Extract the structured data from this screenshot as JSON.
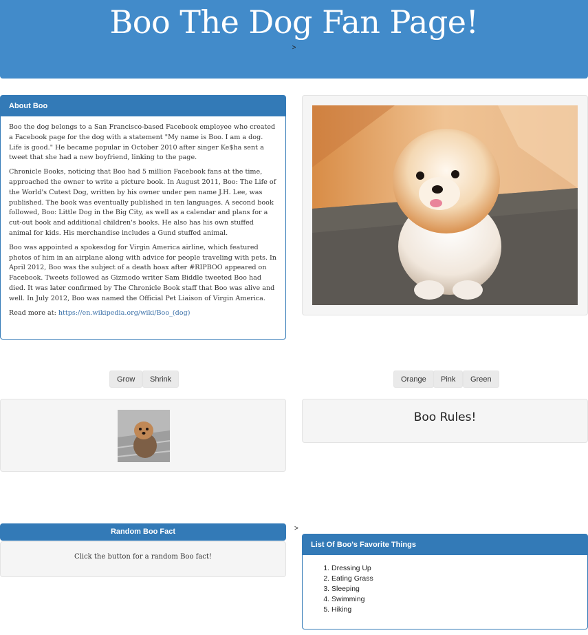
{
  "header": {
    "title": "Boo The Dog Fan Page!",
    "subtitle": ">"
  },
  "about": {
    "heading": "About Boo",
    "paragraphs": [
      "Boo the dog belongs to a San Francisco-based Facebook employee who created a Facebook page for the dog with a statement \"My name is Boo. I am a dog. Life is good.\" He became popular in October 2010 after singer Ke$ha sent a tweet that she had a new boyfriend, linking to the page.",
      "Chronicle Books, noticing that Boo had 5 million Facebook fans at the time, approached the owner to write a picture book. In August 2011, Boo: The Life of the World's Cutest Dog, written by his owner under pen name J.H. Lee, was published. The book was eventually published in ten languages. A second book followed, Boo: Little Dog in the Big City, as well as a calendar and plans for a cut-out book and additional children's books. He also has his own stuffed animal for kids. His merchandise includes a Gund stuffed animal.",
      "Boo was appointed a spokesdog for Virgin America airline, which featured photos of him in an airplane along with advice for people traveling with pets. In April 2012, Boo was the subject of a death hoax after #RIPBOO appeared on Facebook. Tweets followed as Gizmodo writer Sam Biddle tweeted Boo had died. It was later confirmed by The Chronicle Book staff that Boo was alive and well. In July 2012, Boo was named the Official Pet Liaison of Virgin America."
    ],
    "read_more_label": "Read more at: ",
    "read_more_link": "https://en.wikipedia.org/wiki/Boo_(dog)"
  },
  "size_controls": {
    "grow_label": "Grow",
    "shrink_label": "Shrink"
  },
  "color_controls": {
    "orange_label": "Orange",
    "pink_label": "Pink",
    "green_label": "Green"
  },
  "boo_rules": {
    "text": "Boo Rules!"
  },
  "fact": {
    "heading": "Random Boo Fact",
    "text": "Click the button for a random Boo fact!",
    "marker": ">"
  },
  "favorites": {
    "heading": "List Of Boo's Favorite Things",
    "items": [
      "Dressing Up",
      "Eating Grass",
      "Sleeping",
      "Swimming",
      "Hiking"
    ]
  },
  "colors": {
    "header_bg": "#428bca",
    "panel_primary": "#337ab7",
    "well_bg": "#f5f5f5",
    "button_bg": "#eaeaea",
    "link": "#3a70a8"
  },
  "icons": {
    "main_photo": "pomeranian-dog-photo",
    "small_photo": "small-dog-photo"
  }
}
